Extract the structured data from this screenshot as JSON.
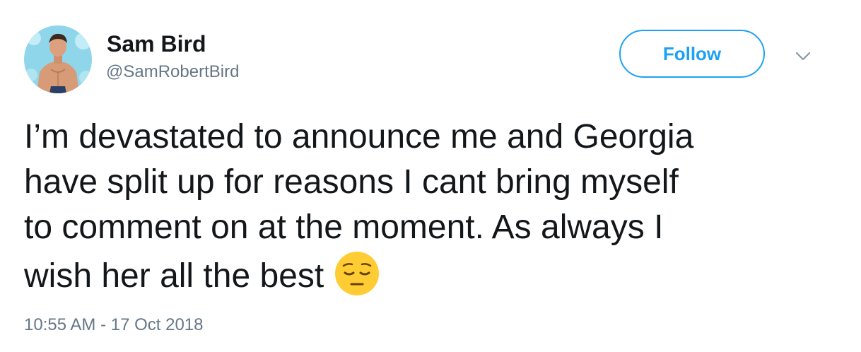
{
  "user": {
    "display_name": "Sam Bird",
    "handle": "@SamRobertBird",
    "avatar_icon": "profile-photo"
  },
  "actions": {
    "follow_label": "Follow",
    "menu_icon": "chevron-down-icon"
  },
  "tweet": {
    "lines": [
      "I’m devastated to announce me and Georgia",
      "have split up for reasons I cant bring myself",
      "to comment on at the moment. As always I",
      "wish her all the best"
    ],
    "emoji": "pensive-face-emoji",
    "timestamp": "10:55 AM - 17 Oct 2018"
  },
  "colors": {
    "accent": "#1da1f2",
    "text": "#14171a",
    "secondary": "#657786",
    "emoji_yellow": "#ffcc33"
  }
}
